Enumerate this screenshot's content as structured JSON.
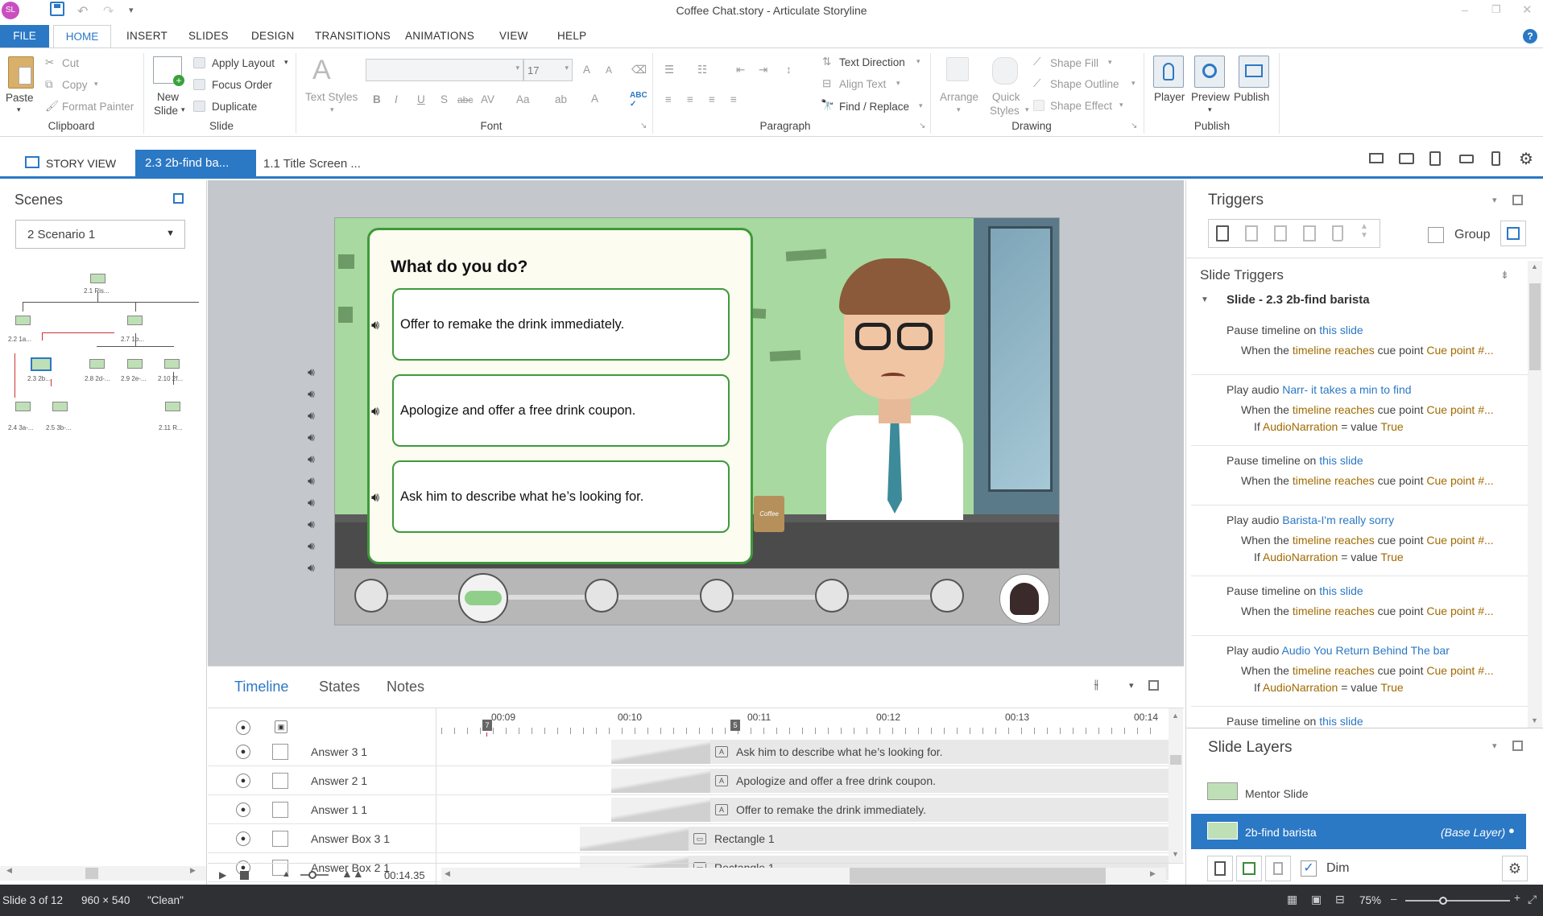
{
  "window": {
    "title": "Coffee Chat.story - Articulate Storyline",
    "app_badge": "SL"
  },
  "menu_tabs": {
    "file": "FILE",
    "home": "HOME",
    "insert": "INSERT",
    "slides": "SLIDES",
    "design": "DESIGN",
    "transitions": "TRANSITIONS",
    "animations": "ANIMATIONS",
    "view": "VIEW",
    "help": "HELP"
  },
  "ribbon": {
    "clipboard": {
      "paste": "Paste",
      "cut": "Cut",
      "copy": "Copy",
      "format_painter": "Format Painter",
      "group": "Clipboard"
    },
    "slide": {
      "new_slide": "New",
      "new_slide2": "Slide",
      "apply_layout": "Apply Layout",
      "focus_order": "Focus Order",
      "duplicate": "Duplicate",
      "group": "Slide"
    },
    "font": {
      "text_styles": "Text Styles",
      "font_size": "17",
      "group": "Font"
    },
    "paragraph": {
      "text_direction": "Text Direction",
      "align_text": "Align Text",
      "find_replace": "Find / Replace",
      "group": "Paragraph"
    },
    "drawing": {
      "arrange": "Arrange",
      "quick_styles": "Quick",
      "quick_styles2": "Styles",
      "shape_fill": "Shape Fill",
      "shape_outline": "Shape Outline",
      "shape_effect": "Shape Effect",
      "group": "Drawing"
    },
    "publish": {
      "player": "Player",
      "preview": "Preview",
      "publish": "Publish",
      "group": "Publish"
    }
  },
  "doc_tabs": {
    "story_view": "STORY VIEW",
    "active": "2.3 2b-find ba...",
    "second": "1.1 Title Screen ..."
  },
  "scenes": {
    "title": "Scenes",
    "selected": "2 Scenario 1",
    "nodes": [
      "2.1 Ris...",
      "2.2 1a...",
      "2.7 1b...",
      "2.3 2b...",
      "2.8 2d-...",
      "2.9 2e-...",
      "2.10 2f...",
      "2.4 3a-...",
      "2.5 3b-...",
      "2.11 R..."
    ]
  },
  "slide": {
    "question": "What do you do?",
    "answers": [
      "Offer to remake the drink immediately.",
      "Apologize and offer a free drink coupon.",
      "Ask him to describe what he’s looking for."
    ],
    "cup_label": "Coffee"
  },
  "timeline": {
    "tabs": {
      "timeline": "Timeline",
      "states": "States",
      "notes": "Notes"
    },
    "ticks": [
      "00:09",
      "00:10",
      "00:11",
      "00:12",
      "00:13",
      "00:14"
    ],
    "rows": [
      {
        "name": "Answer 3 1",
        "bar": "Ask him to describe what he’s looking for."
      },
      {
        "name": "Answer 2 1",
        "bar": "Apologize and offer a free drink coupon."
      },
      {
        "name": "Answer 1 1",
        "bar": "Offer to remake the drink immediately."
      },
      {
        "name": "Answer Box 3 1",
        "bar": "Rectangle 1"
      },
      {
        "name": "Answer Box 2 1",
        "bar": "Rectangle 1"
      }
    ],
    "time": "00:14.35",
    "cue_a": "7",
    "cue_b": "5"
  },
  "triggers": {
    "title": "Triggers",
    "group_label": "Group",
    "section": "Slide Triggers",
    "slide_name": "Slide - 2.3 2b-find barista",
    "items": [
      {
        "action": "Pause timeline on",
        "target": "this slide",
        "when": "When the",
        "w2": "timeline reaches",
        "w3": "cue point",
        "w4": "Cue point #..."
      },
      {
        "action": "Play audio",
        "target": "Narr- it takes a min to find",
        "when": "When the",
        "w2": "timeline reaches",
        "w3": "cue point",
        "w4": "Cue point #...",
        "cond": "If",
        "var": "AudioNarration",
        "eq": "= value",
        "val": "True"
      },
      {
        "action": "Pause timeline on",
        "target": "this slide",
        "when": "When the",
        "w2": "timeline reaches",
        "w3": "cue point",
        "w4": "Cue point #..."
      },
      {
        "action": "Play audio",
        "target": "Barista-I'm really sorry",
        "when": "When the",
        "w2": "timeline reaches",
        "w3": "cue point",
        "w4": "Cue point #...",
        "cond": "If",
        "var": "AudioNarration",
        "eq": "= value",
        "val": "True"
      },
      {
        "action": "Pause timeline on",
        "target": "this slide",
        "when": "When the",
        "w2": "timeline reaches",
        "w3": "cue point",
        "w4": "Cue point #..."
      },
      {
        "action": "Play audio",
        "target": "Audio You Return Behind The bar",
        "when": "When the",
        "w2": "timeline reaches",
        "w3": "cue point",
        "w4": "Cue point #...",
        "cond": "If",
        "var": "AudioNarration",
        "eq": "= value",
        "val": "True"
      },
      {
        "action": "Pause timeline on",
        "target": "this slide"
      }
    ]
  },
  "layers": {
    "title": "Slide Layers",
    "items": [
      {
        "name": "Mentor Slide"
      },
      {
        "name": "2b-find barista",
        "tag": "(Base Layer)"
      }
    ],
    "dim": "Dim"
  },
  "status": {
    "slide": "Slide 3 of 12",
    "size": "960 × 540",
    "theme": "\"Clean\"",
    "zoom": "75%"
  },
  "colors": {
    "accent": "#2b78c5",
    "slide_bg": "#a8d9a0",
    "card_border": "#3d9a3a"
  }
}
